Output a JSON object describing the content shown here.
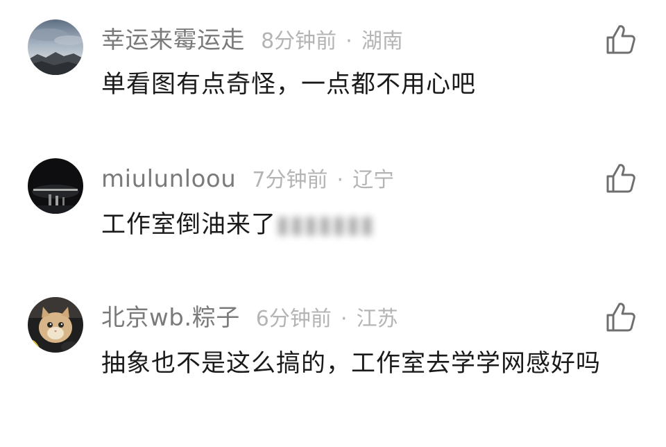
{
  "comments": [
    {
      "username": "幸运来霉运走",
      "time": "8分钟前",
      "separator": "·",
      "location": "湖南",
      "text": "单看图有点奇怪，一点都不用心吧",
      "text_blurred": "",
      "avatar": "mountain-landscape-avatar",
      "like_icon": "thumbs-up-icon"
    },
    {
      "username": "miulunloou",
      "time": "7分钟前",
      "separator": "·",
      "location": "辽宁",
      "text": "工作室倒油来了",
      "text_blurred": "▮▮▮▮▮▮▮",
      "avatar": "night-street-avatar",
      "like_icon": "thumbs-up-icon"
    },
    {
      "username": "北京wb.粽子",
      "time": "6分钟前",
      "separator": "·",
      "location": "江苏",
      "text": "抽象也不是这么搞的，工作室去学学网感好吗",
      "text_blurred": "",
      "avatar": "cat-avatar",
      "like_icon": "thumbs-up-icon"
    }
  ],
  "colors": {
    "username": "#7a7a7a",
    "meta": "#b4b4b4",
    "text": "#1a1a1a",
    "icon": "#6f6f6f",
    "background": "#ffffff"
  }
}
